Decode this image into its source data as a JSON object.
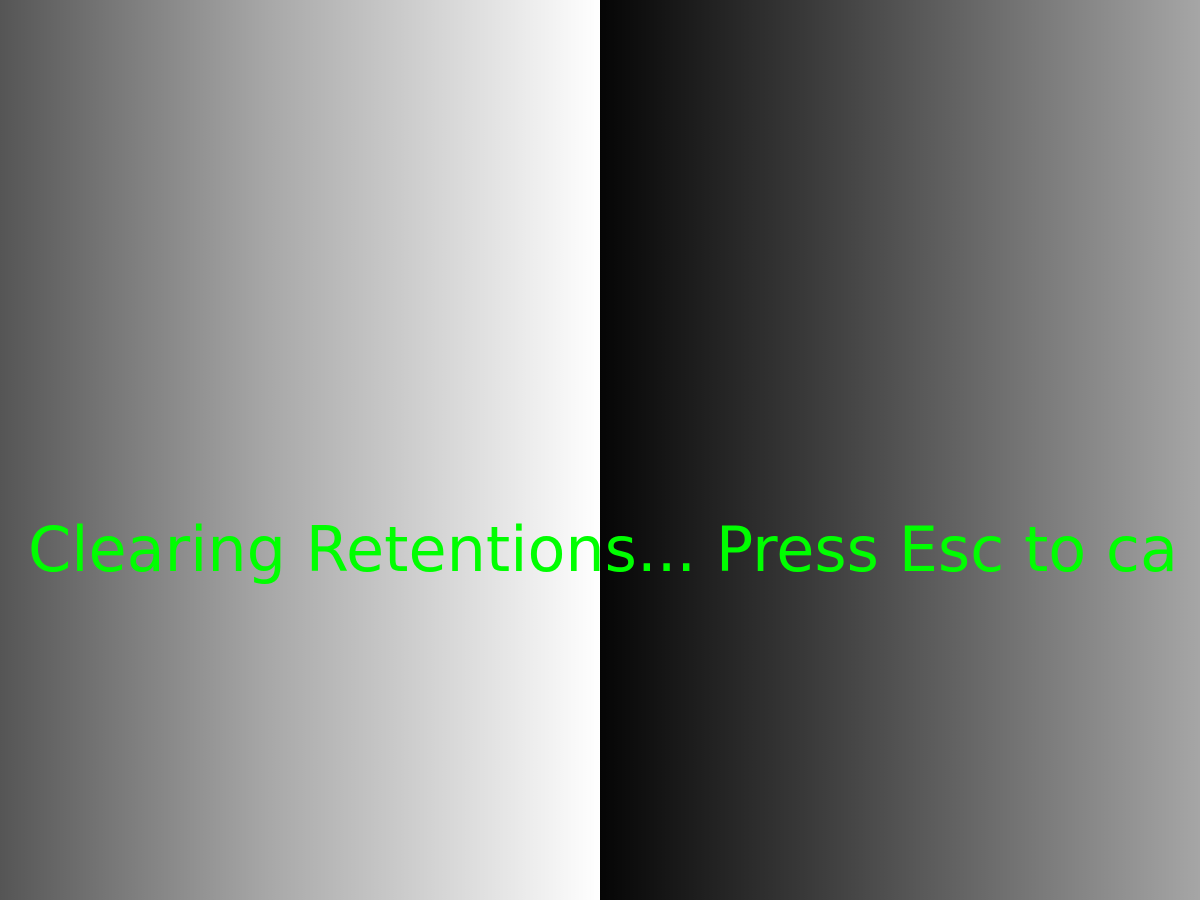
{
  "colors": {
    "status_text": "#00ff00"
  },
  "status": {
    "message": "Clearing Retentions... Press Esc to ca"
  }
}
